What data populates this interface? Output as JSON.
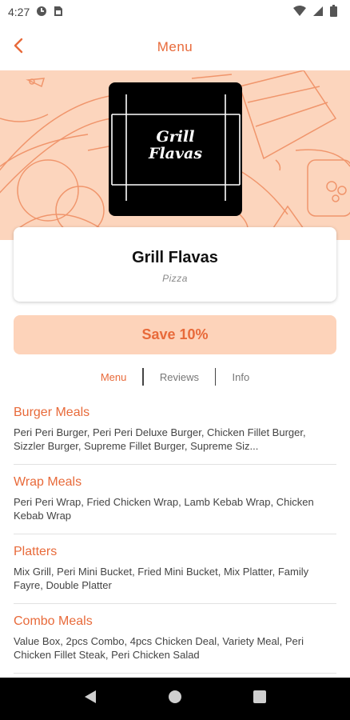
{
  "status_bar": {
    "time": "4:27",
    "icons": [
      "data-saver-icon",
      "sim-card-icon",
      "wifi-icon",
      "signal-icon",
      "battery-icon"
    ]
  },
  "app_bar": {
    "title": "Menu",
    "back_icon": "chevron-left-icon"
  },
  "colors": {
    "accent": "#e86a3a",
    "hero_bg": "#fcd5bd",
    "save_bg": "#fdd3ba"
  },
  "restaurant": {
    "logo_line1": "Grill",
    "logo_line2": "Flavas",
    "name": "Grill Flavas",
    "cuisine": "Pizza"
  },
  "save_button": {
    "label": "Save 10%"
  },
  "tabs": [
    {
      "label": "Menu",
      "active": true
    },
    {
      "label": "Reviews",
      "active": false
    },
    {
      "label": "Info",
      "active": false
    }
  ],
  "menu_items": [
    {
      "category": "Burger Meals",
      "description": "Peri Peri Burger, Peri Peri Deluxe Burger, Chicken Fillet Burger, Sizzler Burger, Supreme Fillet Burger, Supreme Siz..."
    },
    {
      "category": "Wrap Meals",
      "description": "Peri Peri Wrap, Fried Chicken Wrap, Lamb Kebab Wrap, Chicken Kebab Wrap"
    },
    {
      "category": "Platters",
      "description": "Mix Grill, Peri Mini Bucket, Fried Mini Bucket, Mix Platter, Family Fayre, Double Platter"
    },
    {
      "category": "Combo Meals",
      "description": "Value Box, 2pcs Combo, 4pcs Chicken Deal, Variety Meal, Peri Chicken Fillet Steak, Peri Chicken Salad"
    }
  ],
  "nav_bar": {
    "buttons": [
      "back-triangle-icon",
      "home-circle-icon",
      "recents-square-icon"
    ]
  }
}
